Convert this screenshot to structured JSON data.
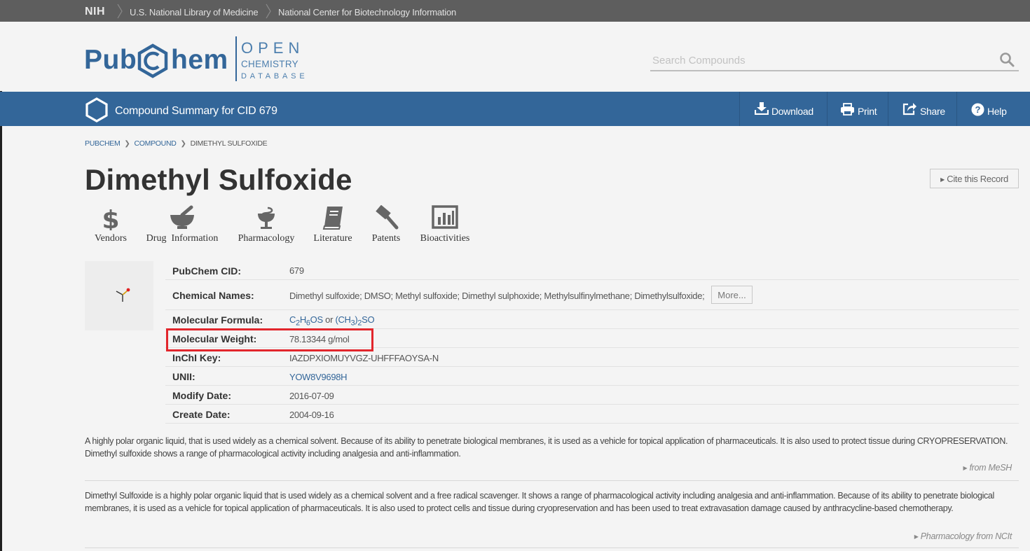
{
  "nih_bar": {
    "nih": "NIH",
    "crumbs": [
      "U.S. National Library of Medicine",
      "National Center for Biotechnology Information"
    ]
  },
  "logo": {
    "pub": "Pub",
    "hem": "hem",
    "open": "OPEN",
    "chemistry": "CHEMISTRY",
    "database": "DATABASE"
  },
  "search": {
    "placeholder": "Search Compounds"
  },
  "toolbar": {
    "title": "Compound Summary for CID 679",
    "download": "Download",
    "print": "Print",
    "share": "Share",
    "help": "Help"
  },
  "breadcrumb": {
    "pubchem": "PUBCHEM",
    "compound": "COMPOUND",
    "current": "DIMETHYL SULFOXIDE"
  },
  "page_title": "Dimethyl Sulfoxide",
  "cite_label": "Cite this Record",
  "quick_links": {
    "vendors": "Vendors",
    "drug_information": "Drug  Information",
    "pharmacology": "Pharmacology",
    "literature": "Literature",
    "patents": "Patents",
    "bioactivities": "Bioactivities"
  },
  "summary": {
    "cid_label": "PubChem CID:",
    "cid_value": "679",
    "names_label": "Chemical Names:",
    "names_value": "Dimethyl sulfoxide; DMSO; Methyl sulfoxide; Dimethyl sulphoxide; Methylsulfinylmethane; Dimethylsulfoxide;",
    "more_label": "More...",
    "formula_label": "Molecular Formula:",
    "formula_parts": {
      "c": "C",
      "c_sub": "2",
      "h": "H",
      "h_sub": "6",
      "os": "OS",
      "or": " or ",
      "ch3_open": "(CH",
      "ch3_sub": "3",
      "close": ")",
      "close_sub": "2",
      "so": "SO"
    },
    "weight_label": "Molecular Weight:",
    "weight_value": "78.13344 g/mol",
    "inchi_label": "InChI Key:",
    "inchi_value": "IAZDPXIOMUYVGZ-UHFFFAOYSA-N",
    "unii_label": "UNII:",
    "unii_value": "YOW8V9698H",
    "modify_label": "Modify Date:",
    "modify_value": "2016-07-09",
    "create_label": "Create Date:",
    "create_value": "2004-09-16"
  },
  "descriptions": {
    "mesh_text": "A highly polar organic liquid, that is used widely as a chemical solvent. Because of its ability to penetrate biological membranes, it is used as a vehicle for topical application of pharmaceuticals. It is also used to protect tissue during CRYOPRESERVATION. Dimethyl sulfoxide shows a range of pharmacological activity including analgesia and anti-inflammation.",
    "mesh_source": "from MeSH",
    "ncit_text": "Dimethyl Sulfoxide is a highly polar organic liquid that is used widely as a chemical solvent and a free radical scavenger. It shows a range of pharmacological activity including analgesia and anti-inflammation. Because of its ability to penetrate biological membranes, it is used as a vehicle for topical application of pharmaceuticals. It is also used to protect cells and tissue during cryopreservation and has been used to treat extravasation damage caused by anthracycline-based chemotherapy.",
    "ncit_source": "Pharmacology from NCIt"
  },
  "colors": {
    "brand_blue": "#336699",
    "nih_gray": "#5e5e5e",
    "highlight_red": "#e2262c"
  },
  "icons": [
    "vendors-dollar-icon",
    "mortar-pestle-icon",
    "bowl-of-hygieia-icon",
    "book-icon",
    "gavel-icon",
    "bar-chart-icon",
    "download-icon",
    "print-icon",
    "share-icon",
    "help-icon",
    "search-icon"
  ]
}
